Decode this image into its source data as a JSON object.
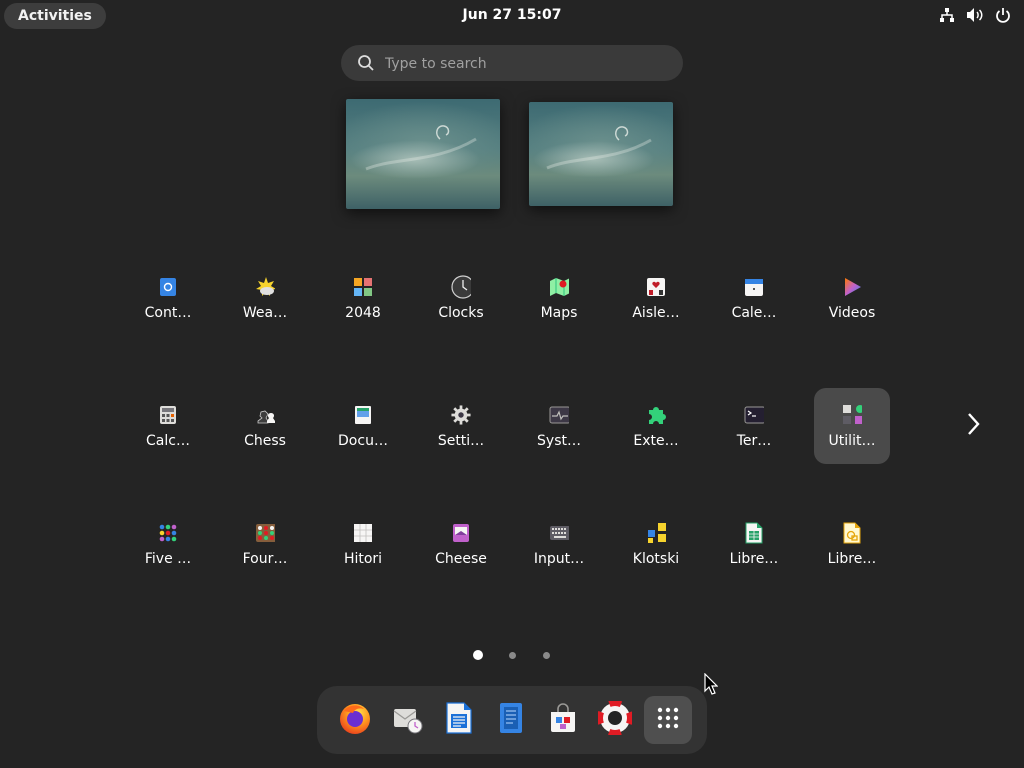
{
  "topbar": {
    "activities_label": "Activities",
    "clock": "Jun 27  15:07",
    "tray_icons": [
      "network-icon",
      "volume-icon",
      "power-icon"
    ]
  },
  "search": {
    "placeholder": "Type to search",
    "value": ""
  },
  "workspaces": [
    {
      "name": "workspace-1"
    },
    {
      "name": "workspace-2"
    }
  ],
  "app_grid": {
    "page_count": 3,
    "active_page": 1,
    "rows": [
      [
        {
          "label": "Cont…",
          "icon": "contacts-icon"
        },
        {
          "label": "Wea…",
          "icon": "weather-icon"
        },
        {
          "label": "2048",
          "icon": "2048-icon"
        },
        {
          "label": "Clocks",
          "icon": "clocks-icon"
        },
        {
          "label": "Maps",
          "icon": "maps-icon"
        },
        {
          "label": "Aisle…",
          "icon": "aisleriot-icon"
        },
        {
          "label": "Cale…",
          "icon": "calendar-icon"
        },
        {
          "label": "Videos",
          "icon": "videos-icon"
        }
      ],
      [
        {
          "label": "Calc…",
          "icon": "calculator-icon"
        },
        {
          "label": "Chess",
          "icon": "chess-icon"
        },
        {
          "label": "Docu…",
          "icon": "document-viewer-icon"
        },
        {
          "label": "Setti…",
          "icon": "settings-icon"
        },
        {
          "label": "Syst…",
          "icon": "system-monitor-icon"
        },
        {
          "label": "Exte…",
          "icon": "extensions-icon"
        },
        {
          "label": "Ter…",
          "icon": "terminal-icon"
        },
        {
          "label": "Utilit…",
          "icon": "utilities-folder-icon",
          "selected": true
        }
      ],
      [
        {
          "label": "Five …",
          "icon": "five-or-more-icon"
        },
        {
          "label": "Four…",
          "icon": "four-in-a-row-icon"
        },
        {
          "label": "Hitori",
          "icon": "hitori-icon"
        },
        {
          "label": "Cheese",
          "icon": "cheese-icon"
        },
        {
          "label": "Input…",
          "icon": "input-method-icon"
        },
        {
          "label": "Klotski",
          "icon": "klotski-icon"
        },
        {
          "label": "Libre…",
          "icon": "libreoffice-calc-icon"
        },
        {
          "label": "Libre…",
          "icon": "libreoffice-draw-icon"
        }
      ]
    ]
  },
  "dash": {
    "items": [
      {
        "name": "firefox",
        "icon": "firefox-icon"
      },
      {
        "name": "evolution",
        "icon": "mail-clock-icon"
      },
      {
        "name": "libreoffice-writer",
        "icon": "writer-icon"
      },
      {
        "name": "text-editor",
        "icon": "text-editor-icon"
      },
      {
        "name": "software",
        "icon": "software-store-icon"
      },
      {
        "name": "help",
        "icon": "help-lifebuoy-icon"
      },
      {
        "name": "show-apps",
        "icon": "app-grid-icon"
      }
    ]
  }
}
